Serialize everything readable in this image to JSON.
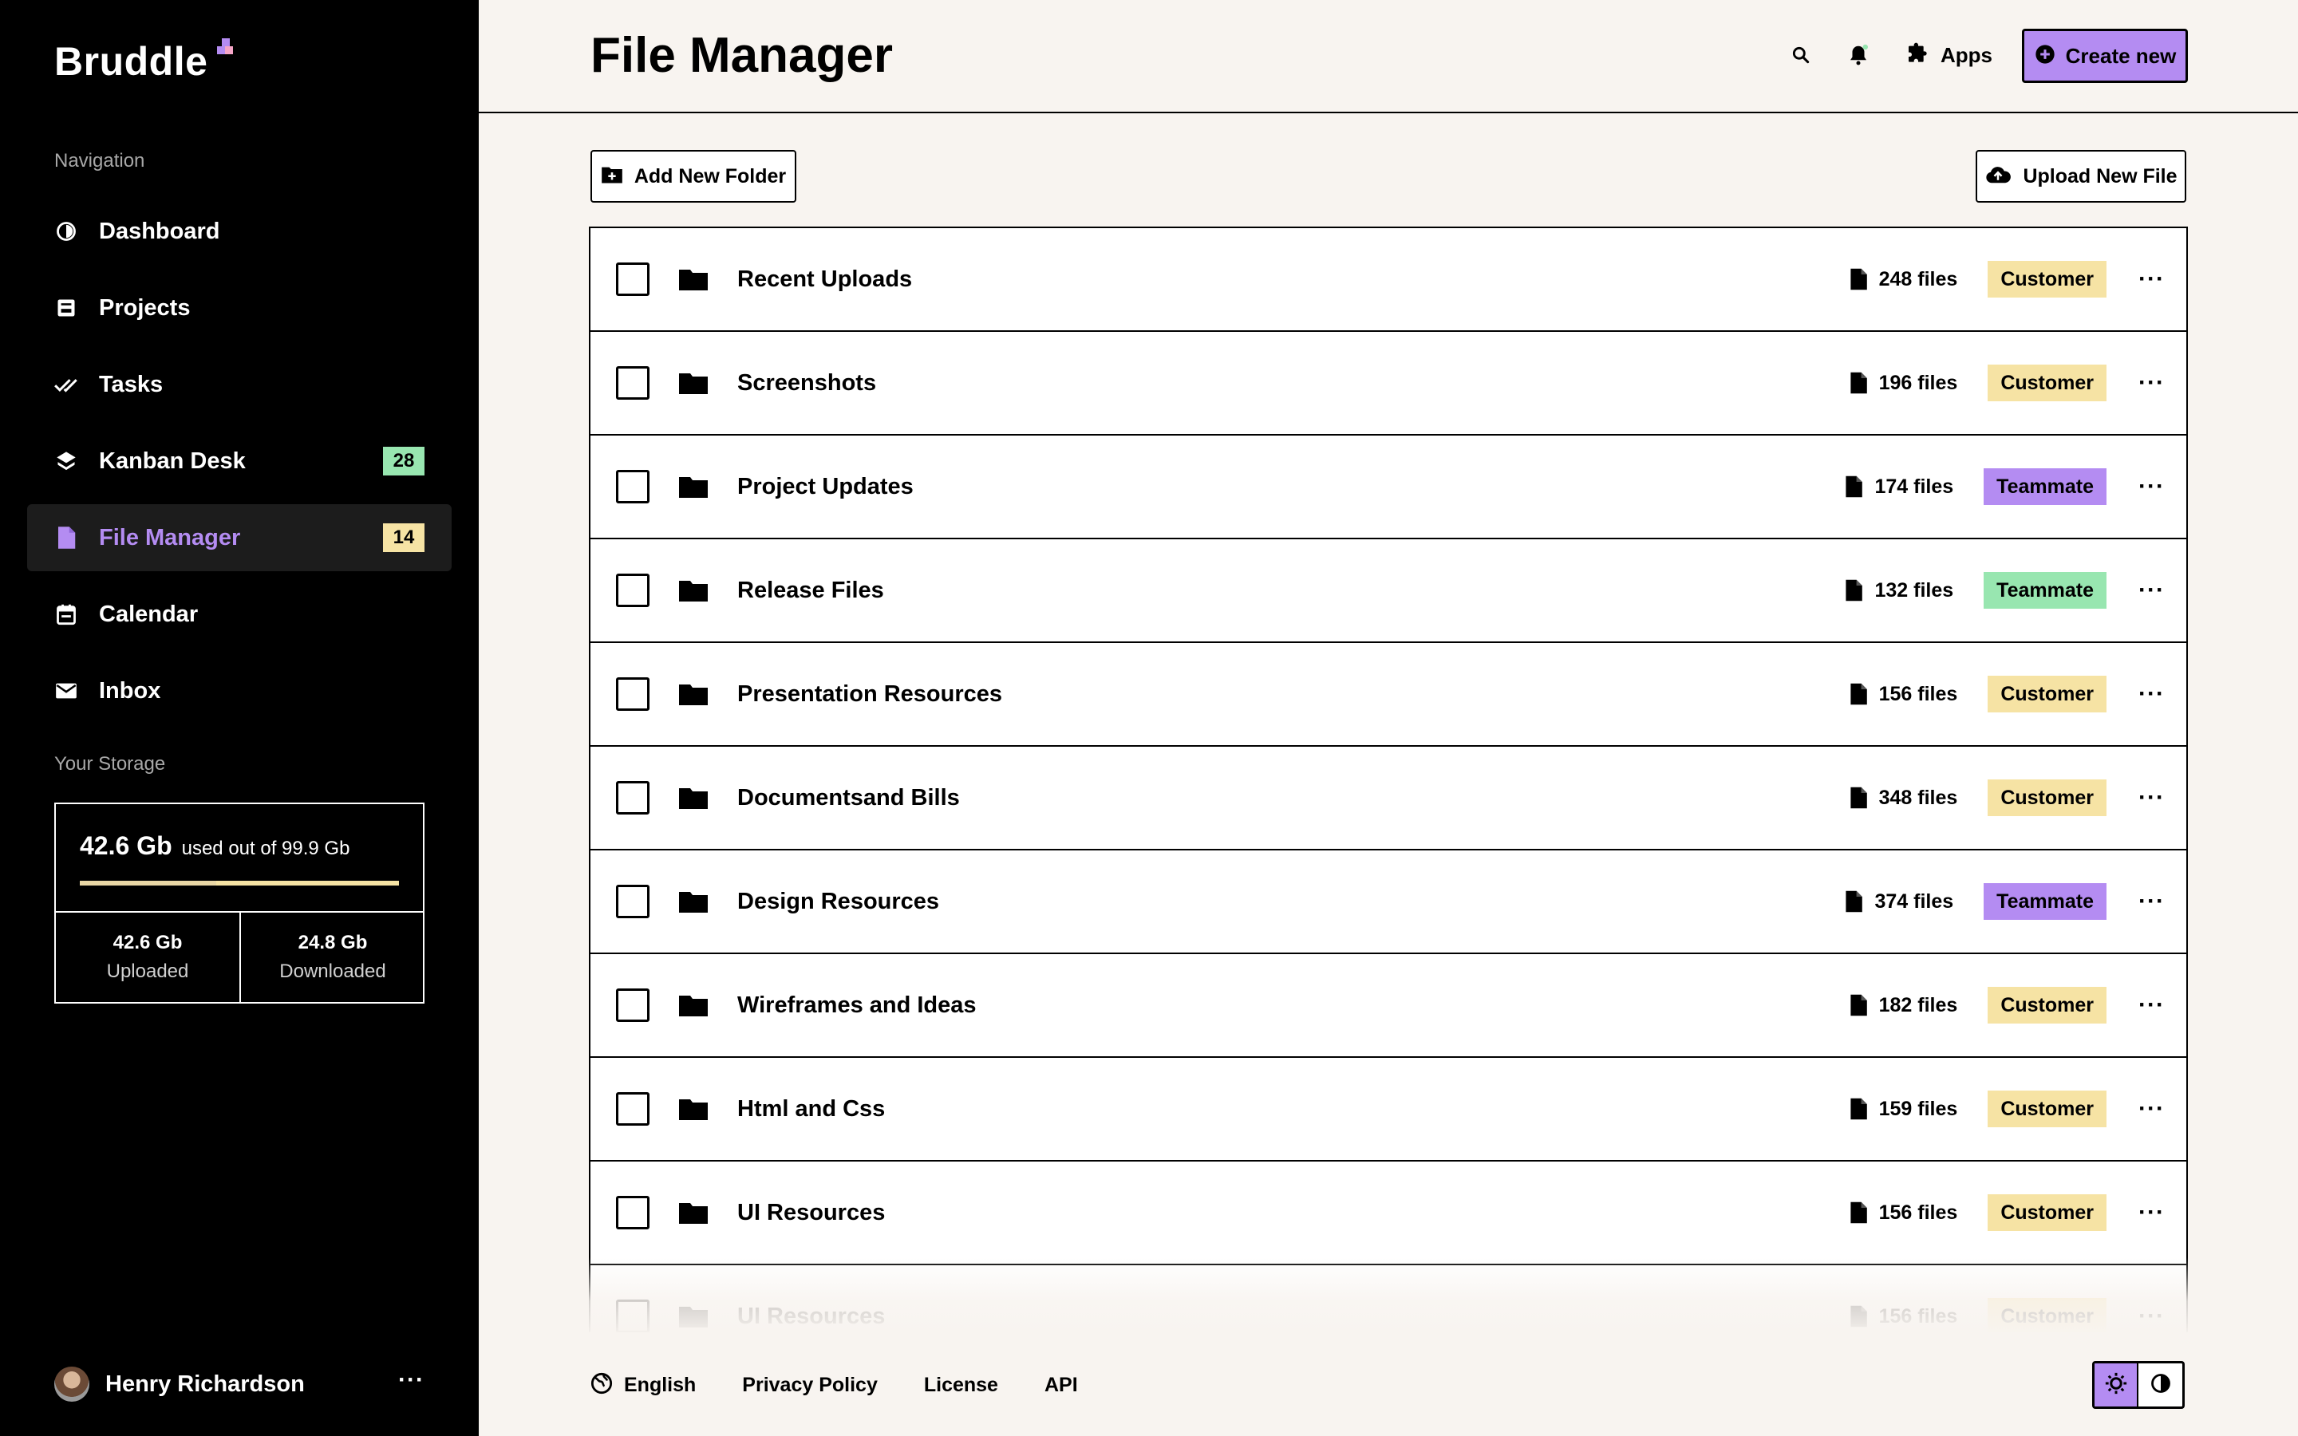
{
  "app": {
    "logo": "Bruddle"
  },
  "colors": {
    "accent": "#b48cf2",
    "yellow": "#f6e3a4",
    "green": "#98e6b0",
    "purple": "#b48cf2"
  },
  "sidebar": {
    "nav_heading": "Navigation",
    "items": [
      {
        "label": "Dashboard",
        "icon": "dashboard-icon"
      },
      {
        "label": "Projects",
        "icon": "projects-icon"
      },
      {
        "label": "Tasks",
        "icon": "double-check-icon"
      },
      {
        "label": "Kanban Desk",
        "icon": "layers-icon",
        "badge": "28",
        "badge_color": "#98e6b0"
      },
      {
        "label": "File Manager",
        "icon": "document-icon",
        "badge": "14",
        "badge_color": "#f6e3a4",
        "active": true
      },
      {
        "label": "Calendar",
        "icon": "calendar-icon"
      },
      {
        "label": "Inbox",
        "icon": "mail-icon"
      }
    ],
    "storage": {
      "heading": "Your Storage",
      "used": "42.6 Gb",
      "of_text": "used out of 99.9 Gb",
      "used_fraction": 0.4264,
      "uploaded_value": "42.6 Gb",
      "uploaded_label": "Uploaded",
      "downloaded_value": "24.8 Gb",
      "downloaded_label": "Downloaded"
    },
    "user": {
      "name": "Henry Richardson"
    }
  },
  "header": {
    "title": "File Manager",
    "apps_label": "Apps",
    "create_label": "Create new"
  },
  "toolbar": {
    "add_folder_label": "Add New Folder",
    "upload_label": "Upload New File"
  },
  "folders": [
    {
      "name": "Recent Uploads",
      "count": "248 files",
      "tag": "Customer",
      "tag_color": "#f6e3a4"
    },
    {
      "name": "Screenshots",
      "count": "196 files",
      "tag": "Customer",
      "tag_color": "#f6e3a4"
    },
    {
      "name": "Project Updates",
      "count": "174 files",
      "tag": "Teammate",
      "tag_color": "#b48cf2"
    },
    {
      "name": "Release Files",
      "count": "132 files",
      "tag": "Teammate",
      "tag_color": "#98e6b0"
    },
    {
      "name": "Presentation Resources",
      "count": "156 files",
      "tag": "Customer",
      "tag_color": "#f6e3a4"
    },
    {
      "name": "Documentsand Bills",
      "count": "348 files",
      "tag": "Customer",
      "tag_color": "#f6e3a4"
    },
    {
      "name": "Design Resources",
      "count": "374 files",
      "tag": "Teammate",
      "tag_color": "#b48cf2"
    },
    {
      "name": "Wireframes and Ideas",
      "count": "182 files",
      "tag": "Customer",
      "tag_color": "#f6e3a4"
    },
    {
      "name": "Html and Css",
      "count": "159 files",
      "tag": "Customer",
      "tag_color": "#f6e3a4"
    },
    {
      "name": "UI Resources",
      "count": "156 files",
      "tag": "Customer",
      "tag_color": "#f6e3a4"
    },
    {
      "name": "UI Resources",
      "count": "156 files",
      "tag": "Customer",
      "tag_color": "#f6e3a4"
    }
  ],
  "footer": {
    "language": "English",
    "links": [
      "Privacy Policy",
      "License",
      "API"
    ]
  }
}
